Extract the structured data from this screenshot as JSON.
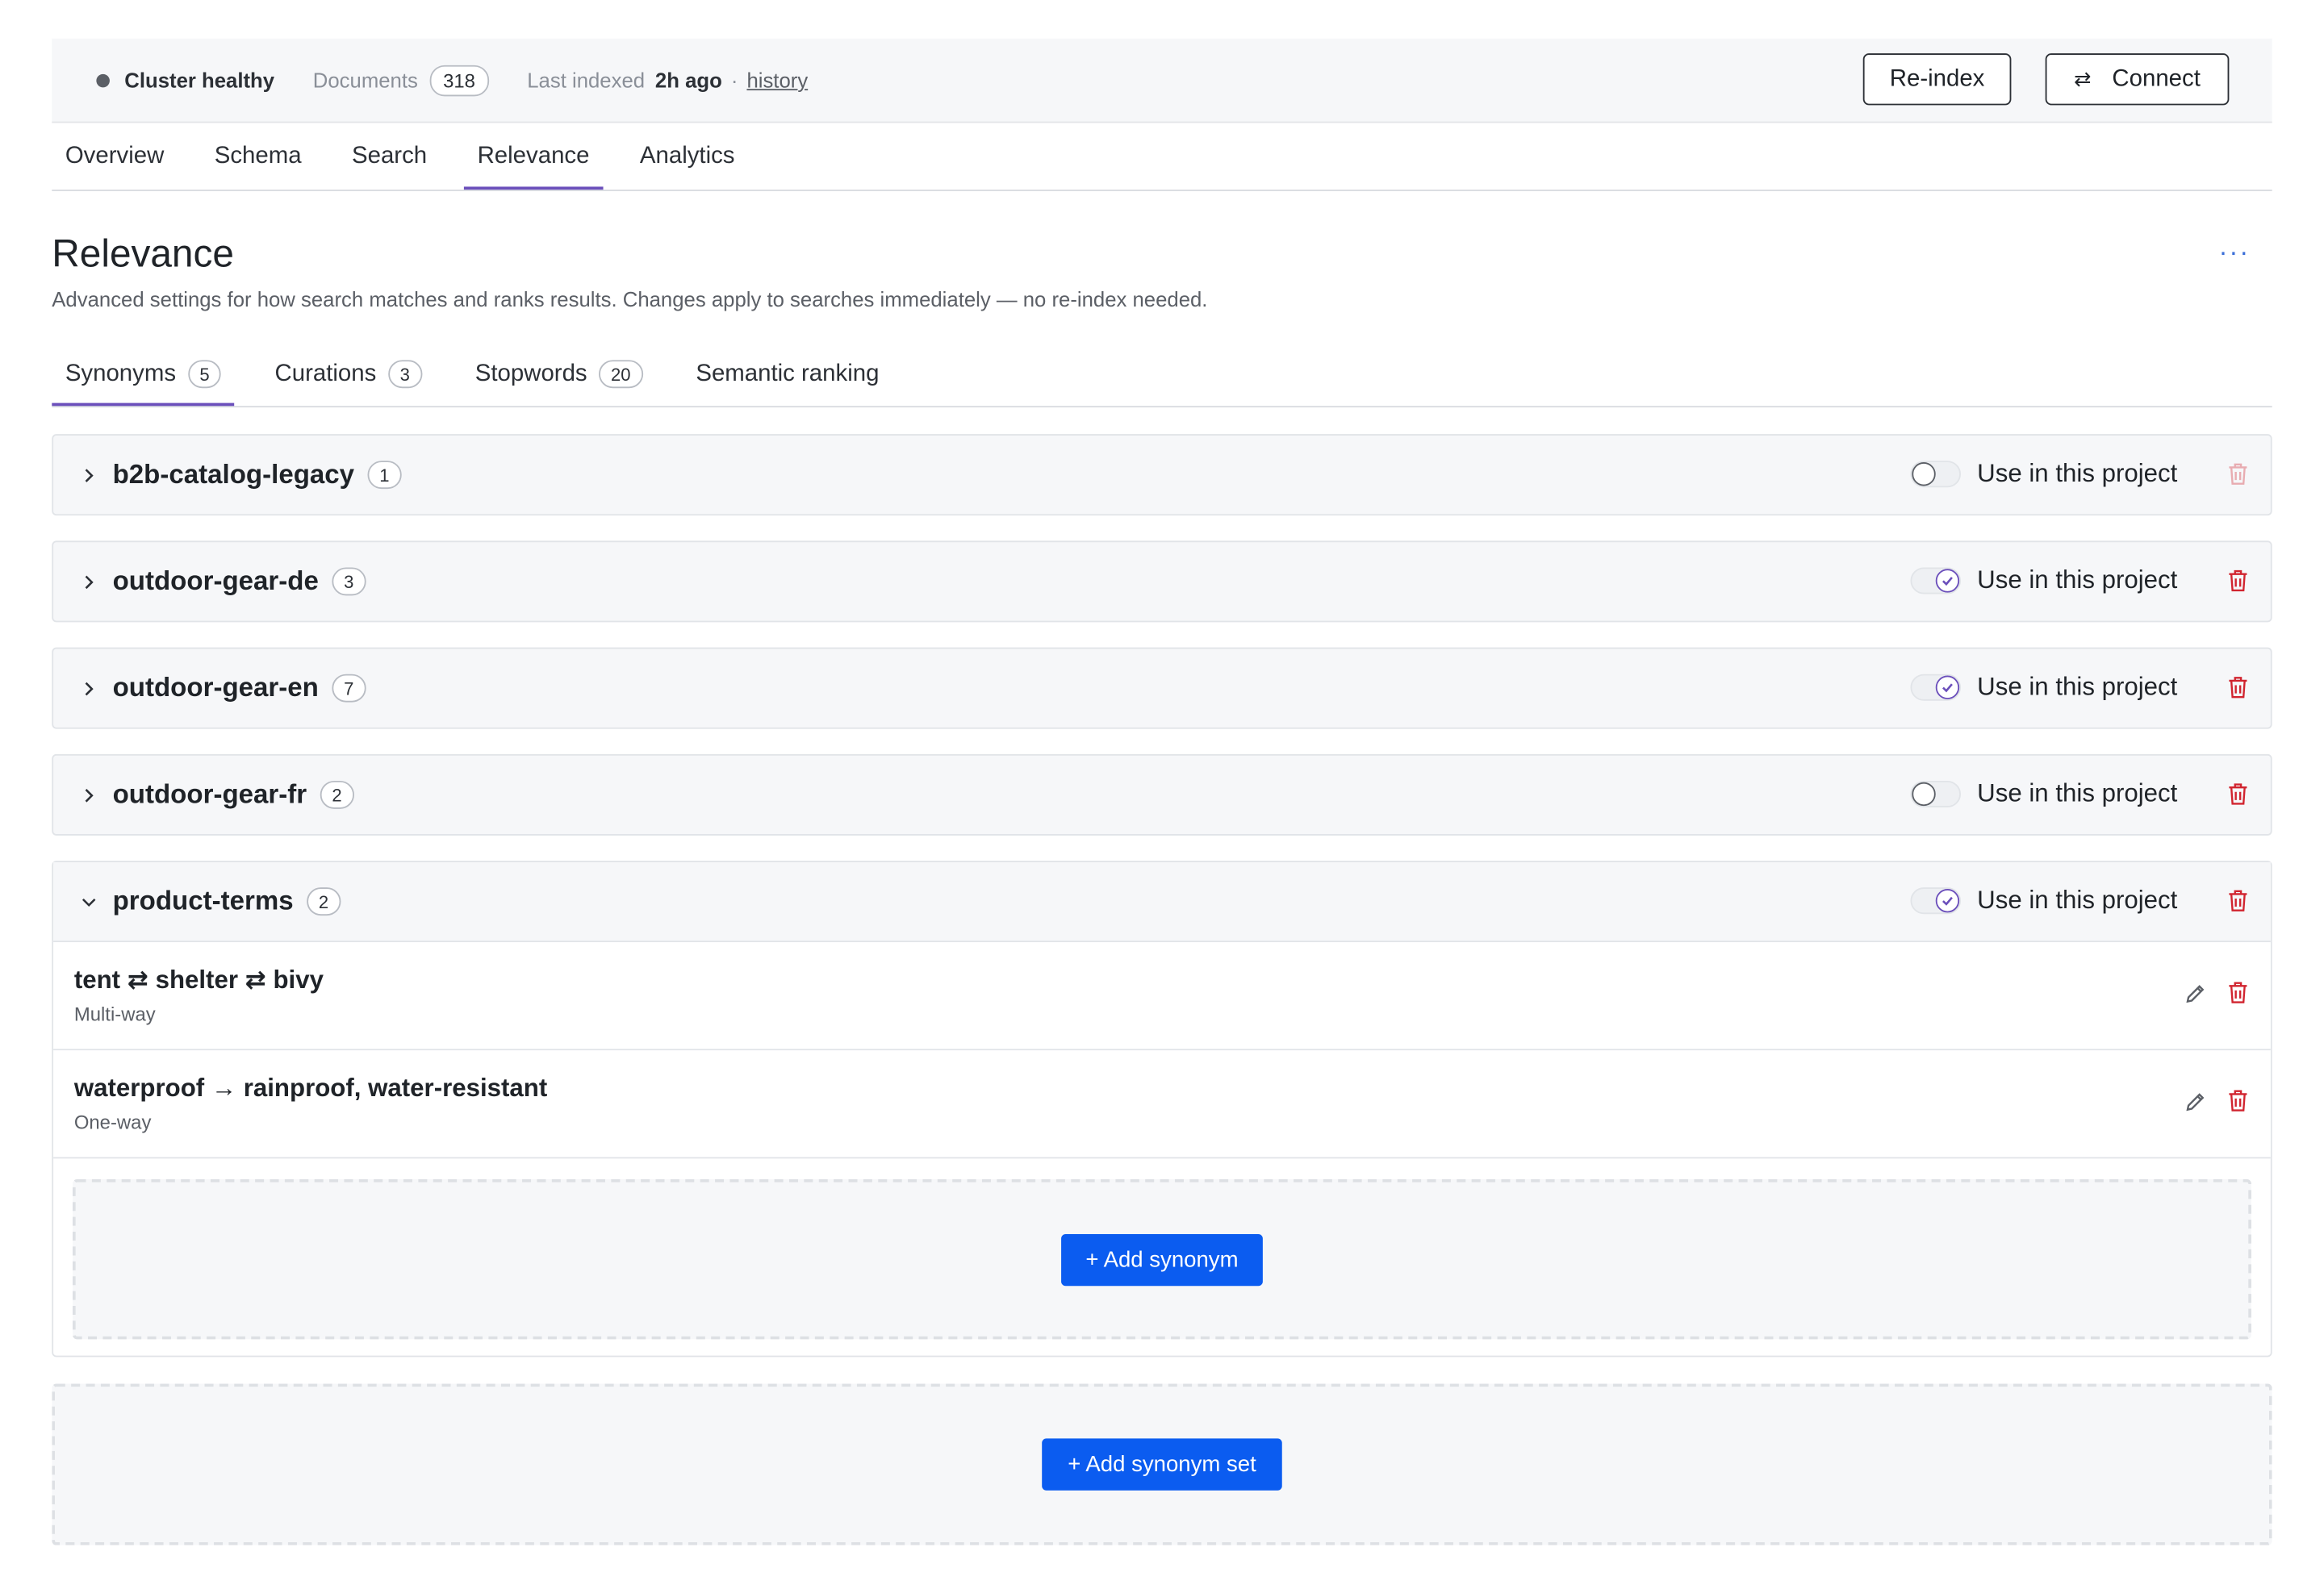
{
  "status": {
    "cluster": "Cluster healthy",
    "documents_label": "Documents",
    "documents_count": "318",
    "last_indexed_label": "Last indexed",
    "last_indexed_value": "2h ago",
    "separator": "·",
    "history_link": "history"
  },
  "actions": {
    "reindex": "Re-index",
    "connect": "Connect",
    "connect_icon": "swap-arrows-icon"
  },
  "nav_tabs": [
    {
      "label": "Overview"
    },
    {
      "label": "Schema"
    },
    {
      "label": "Search"
    },
    {
      "label": "Relevance",
      "active": true
    },
    {
      "label": "Analytics"
    }
  ],
  "page": {
    "title": "Relevance",
    "description": "Advanced settings for how search matches and ranks results. Changes apply to searches immediately — no re-index needed.",
    "more": "···"
  },
  "sub_tabs": [
    {
      "label": "Synonyms",
      "count": "5",
      "active": true
    },
    {
      "label": "Curations",
      "count": "3"
    },
    {
      "label": "Stopwords",
      "count": "20"
    },
    {
      "label": "Semantic ranking"
    }
  ],
  "toggle_label": "Use in this project",
  "synonym_sets": [
    {
      "name": "b2b-catalog-legacy",
      "count": "1",
      "enabled": false,
      "expanded": false
    },
    {
      "name": "outdoor-gear-de",
      "count": "3",
      "enabled": true,
      "expanded": false
    },
    {
      "name": "outdoor-gear-en",
      "count": "7",
      "enabled": true,
      "expanded": false
    },
    {
      "name": "outdoor-gear-fr",
      "count": "2",
      "enabled": false,
      "expanded": false
    },
    {
      "name": "product-terms",
      "count": "2",
      "enabled": true,
      "expanded": true,
      "synonyms": [
        {
          "terms": "tent ⇄ shelter ⇄ bivy",
          "type": "Multi-way"
        },
        {
          "terms": "waterproof → rainproof, water-resistant",
          "type": "One-way"
        }
      ]
    }
  ],
  "add_synonym": "+ Add synonym",
  "add_synonym_set": "+ Add synonym set",
  "colors": {
    "accent": "#6b4fbb",
    "primary_button": "#0b5cf0",
    "danger": "#d1242f"
  }
}
